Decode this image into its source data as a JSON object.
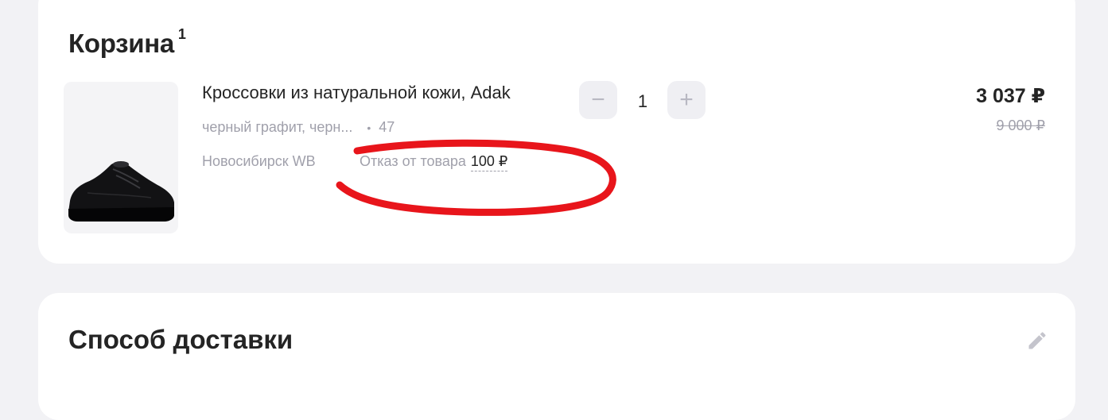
{
  "cart": {
    "title": "Корзина",
    "count": "1",
    "item": {
      "name": "Кроссовки из натуральной кожи, Adak",
      "color": "черный графит, черн...",
      "size": "47",
      "warehouse": "Новосибирск WB",
      "refusal_label": "Отказ от товара",
      "refusal_price": "100 ₽",
      "quantity": "1",
      "price": "3 037 ₽",
      "old_price": "9 000 ₽"
    }
  },
  "delivery": {
    "title": "Способ доставки",
    "address_partial": "",
    "icon": "pencil-icon"
  },
  "colors": {
    "background": "#f2f2f5",
    "card": "#ffffff",
    "muted_text": "#a0a0ab",
    "annotation": "#e8151b"
  }
}
